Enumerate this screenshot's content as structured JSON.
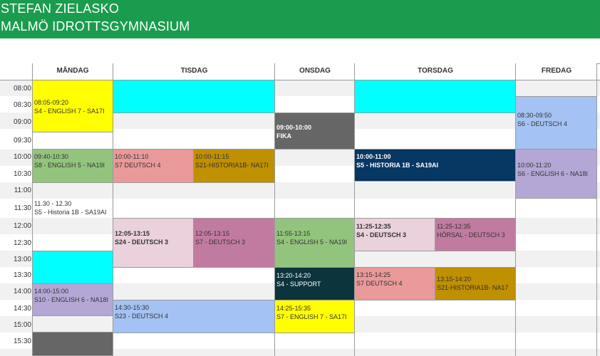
{
  "header": {
    "name": "STEFAN ZIELASKO",
    "school": "MALMÖ IDROTTSGYMNASIUM"
  },
  "days": [
    "MÅNDAG",
    "TISDAG",
    "ONSDAG",
    "TORSDAG",
    "FREDAG"
  ],
  "times": [
    "08:00",
    "08:30",
    "09:00",
    "09:30",
    "10:00",
    "10:30",
    "11:00",
    "11:30",
    "12:00",
    "12:30",
    "13:00",
    "13:30",
    "14:00",
    "14:30",
    "15:00",
    "15:30"
  ],
  "colors": {
    "header": "#1a9c4e",
    "yellow": "#ffff00",
    "cyan": "#00ffff",
    "green": "#93c47d",
    "lavender": "#b4a7d6",
    "salmon": "#ea9999",
    "gold": "#bf9000",
    "lightpink": "#ead1dc",
    "mauve": "#c27ba0",
    "blue": "#a4c2f4",
    "darkgray": "#666666",
    "navy": "#073763",
    "darkteal": "#0c343d"
  },
  "events": {
    "mon_1": {
      "time": "08:05-09:20",
      "title": "S4 - ENGLISH 7 - SA17I",
      "color": "#ffff00"
    },
    "mon_2": {
      "time": "09:40-10:30",
      "title": "S8 - ENGLISH 5 - NA19I",
      "color": "#93c47d"
    },
    "mon_3": {
      "time": "11.30 - 12.30",
      "title": "S5 - Historia 1B - SA19AI",
      "color": "#ffffff"
    },
    "mon_4": {
      "time": "",
      "title": "",
      "color": "#00ffff"
    },
    "mon_5": {
      "time": "14:00-15:00",
      "title": "S10 - ENGLISH 6 - NA18I",
      "color": "#b4a7d6"
    },
    "mon_6": {
      "time": "",
      "title": "",
      "color": "#666666"
    },
    "tue_1": {
      "time": "",
      "title": "",
      "color": "#00ffff"
    },
    "tue_2": {
      "time": "10:00-11:10",
      "title": "S7 DEUTSCH 4",
      "color": "#ea9999"
    },
    "tue_3": {
      "time": "10:00-11:15",
      "title": "S21-HISTORIA1B- NA17I",
      "color": "#bf9000"
    },
    "tue_4": {
      "time": "12:05-13:15",
      "title": "S24 - DEUTSCH 3",
      "color": "#ead1dc"
    },
    "tue_5": {
      "time": "12:05-13:15",
      "title": "S7 - DEUTSCH 3",
      "color": "#c27ba0"
    },
    "tue_6": {
      "time": "14:30-15:30",
      "title": "S23 - DEUTSCH 4",
      "color": "#a4c2f4"
    },
    "wed_1": {
      "time": "09:00-10:00",
      "title": "FIKA",
      "color": "#666666"
    },
    "wed_2": {
      "time": "11:55-13:15",
      "title": "S4 - ENGLISH 5 - NA19I",
      "color": "#93c47d"
    },
    "wed_3": {
      "time": "13:20-14:20",
      "title": "S4 - SUPPORT",
      "color": "#0c343d"
    },
    "wed_4": {
      "time": "14:25-15:35",
      "title": "S7 - ENGLISH 7 - SA17I",
      "color": "#ffff00"
    },
    "thu_1": {
      "time": "",
      "title": "",
      "color": "#00ffff"
    },
    "thu_2": {
      "time": "10:00-11:00",
      "title": "S5 - HISTORIA 1B - SA19AI",
      "color": "#073763"
    },
    "thu_3": {
      "time": "11:25-12:35",
      "title": "S4 - DEUTSCH 3",
      "color": "#ead1dc"
    },
    "thu_4": {
      "time": "11:25-12:35",
      "title": "HÖRSAL - DEUTSCH 3",
      "color": "#c27ba0"
    },
    "thu_5": {
      "time": "13:15-14:25",
      "title": "S7 DEUTSCH 4",
      "color": "#ea9999"
    },
    "thu_6": {
      "time": "13:15-14:20",
      "title": "S21-HISTORIA1B- NA17",
      "color": "#bf9000"
    },
    "fri_1": {
      "time": "08:30-09:50",
      "title": "S6 - DEUTSCH 4",
      "color": "#a4c2f4"
    },
    "fri_2": {
      "time": "10:00-11:20",
      "title": "S6 - ENGLISH 6 - NA18I",
      "color": "#b4a7d6"
    }
  }
}
